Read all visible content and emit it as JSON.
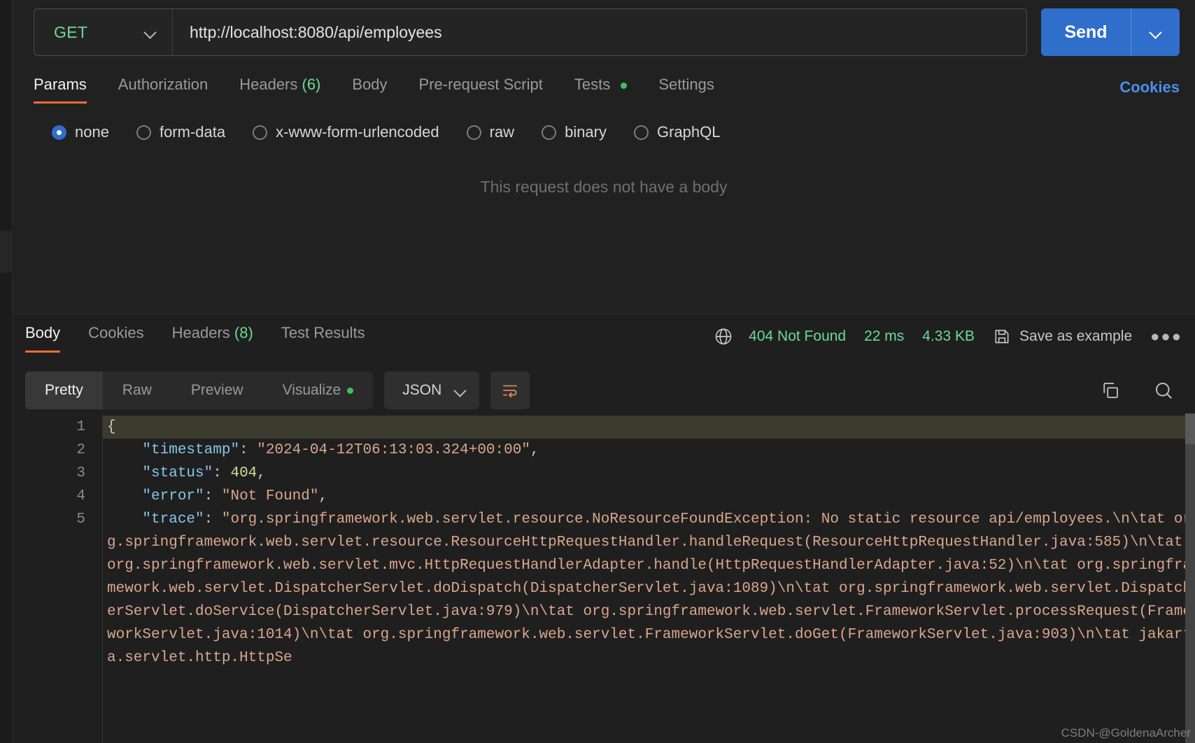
{
  "request": {
    "method": "GET",
    "method_icon": "chevron-down-icon",
    "url": "http://localhost:8080/api/employees",
    "send_label": "Send",
    "send_dropdown_icon": "chevron-down-icon",
    "tabs": [
      {
        "label": "Params",
        "count": "",
        "active": false,
        "dot": false
      },
      {
        "label": "Authorization",
        "count": "",
        "active": false,
        "dot": false
      },
      {
        "label": "Headers",
        "count": "(6)",
        "active": false,
        "dot": false
      },
      {
        "label": "Body",
        "count": "",
        "active": true,
        "dot": false
      },
      {
        "label": "Pre-request Script",
        "count": "",
        "active": false,
        "dot": false
      },
      {
        "label": "Tests",
        "count": "",
        "active": false,
        "dot": true
      },
      {
        "label": "Settings",
        "count": "",
        "active": false,
        "dot": false
      }
    ],
    "cookies_link": "Cookies",
    "body_types": [
      {
        "label": "none",
        "selected": true
      },
      {
        "label": "form-data",
        "selected": false
      },
      {
        "label": "x-www-form-urlencoded",
        "selected": false
      },
      {
        "label": "raw",
        "selected": false
      },
      {
        "label": "binary",
        "selected": false
      },
      {
        "label": "GraphQL",
        "selected": false
      }
    ],
    "empty_body_message": "This request does not have a body"
  },
  "response": {
    "tabs": [
      {
        "label": "Body",
        "count": "",
        "active": true
      },
      {
        "label": "Cookies",
        "count": "",
        "active": false
      },
      {
        "label": "Headers",
        "count": "(8)",
        "active": false
      },
      {
        "label": "Test Results",
        "count": "",
        "active": false
      }
    ],
    "status": {
      "globe_icon": "globe-icon",
      "code_text": "404 Not Found",
      "time": "22 ms",
      "size": "4.33 KB",
      "save_icon": "save-icon",
      "save_label": "Save as example",
      "more_icon": "ellipsis-icon"
    },
    "format_tabs": [
      {
        "label": "Pretty",
        "active": true,
        "dot": false
      },
      {
        "label": "Raw",
        "active": false,
        "dot": false
      },
      {
        "label": "Preview",
        "active": false,
        "dot": false
      },
      {
        "label": "Visualize",
        "active": false,
        "dot": true
      }
    ],
    "language_select": "JSON",
    "language_select_icon": "chevron-down-icon",
    "wrap_icon": "word-wrap-icon",
    "copy_icon": "copy-icon",
    "search_icon": "search-icon",
    "line_numbers": [
      "1",
      "2",
      "3",
      "4",
      "5"
    ],
    "json": {
      "open_brace": "{",
      "timestamp_key": "\"timestamp\"",
      "timestamp_value": "\"2024-04-12T06:13:03.324+00:00\"",
      "status_key": "\"status\"",
      "status_value": "404",
      "error_key": "\"error\"",
      "error_value": "\"Not Found\"",
      "trace_key": "\"trace\"",
      "trace_value": "\"org.springframework.web.servlet.resource.NoResourceFoundException: No static resource api/employees.\\n\\tat org.springframework.web.servlet.resource.ResourceHttpRequestHandler.handleRequest(ResourceHttpRequestHandler.java:585)\\n\\tat org.springframework.web.servlet.mvc.HttpRequestHandlerAdapter.handle(HttpRequestHandlerAdapter.java:52)\\n\\tat org.springframework.web.servlet.DispatcherServlet.doDispatch(DispatcherServlet.java:1089)\\n\\tat org.springframework.web.servlet.DispatcherServlet.doService(DispatcherServlet.java:979)\\n\\tat org.springframework.web.servlet.FrameworkServlet.processRequest(FrameworkServlet.java:1014)\\n\\tat org.springframework.web.servlet.FrameworkServlet.doGet(FrameworkServlet.java:903)\\n\\tat jakarta.servlet.http.HttpSe"
    }
  },
  "watermark": "CSDN-@GoldenaArcher",
  "colors": {
    "accent_orange": "#ef6c33",
    "send_blue": "#2f6ecb",
    "status_green": "#6bdb8f",
    "link_blue": "#4a8fe8",
    "json_key": "#88c5e8",
    "json_string": "#dba68b",
    "json_number": "#cfdd9a"
  }
}
